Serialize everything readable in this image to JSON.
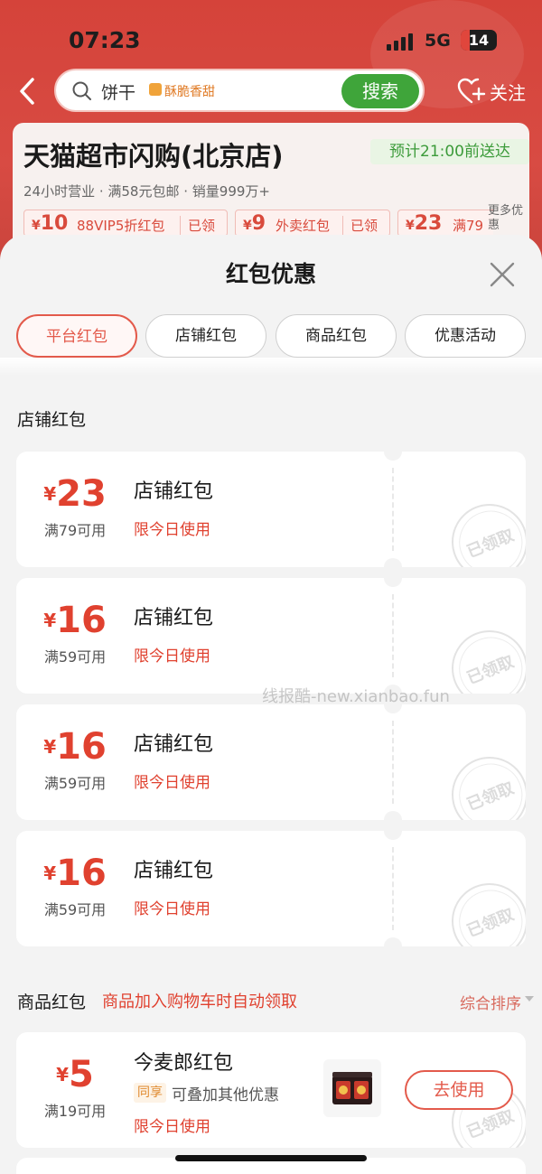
{
  "status": {
    "time": "07:23",
    "network": "5G",
    "battery": "14"
  },
  "header": {
    "search_text": "饼干",
    "search_tag": "酥脆香甜",
    "search_button": "搜索",
    "follow_label": "关注"
  },
  "store": {
    "name": "天猫超市闪购(北京店)",
    "eta": "预计21:00前送达",
    "meta": "24小时营业 · 满58元包邮 · 销量999万+",
    "coupons": [
      {
        "amount": "10",
        "desc": "88VIP5折红包",
        "status": "已领"
      },
      {
        "amount": "9",
        "desc": "外卖红包",
        "status": "已领"
      },
      {
        "amount": "23",
        "desc": "满79",
        "status": ""
      }
    ],
    "more": "更多优惠"
  },
  "sheet": {
    "title": "红包优惠",
    "tabs": [
      "平台红包",
      "店铺红包",
      "商品红包",
      "优惠活动"
    ],
    "active_tab": 0,
    "store_section_title": "店铺红包",
    "store_coupons": [
      {
        "amount": "23",
        "condition": "满79可用",
        "name": "店铺红包",
        "limit": "限今日使用",
        "stamp": "已领取"
      },
      {
        "amount": "16",
        "condition": "满59可用",
        "name": "店铺红包",
        "limit": "限今日使用",
        "stamp": "已领取"
      },
      {
        "amount": "16",
        "condition": "满59可用",
        "name": "店铺红包",
        "limit": "限今日使用",
        "stamp": "已领取"
      },
      {
        "amount": "16",
        "condition": "满59可用",
        "name": "店铺红包",
        "limit": "限今日使用",
        "stamp": "已领取"
      }
    ],
    "watermark": "线报酷-new.xianbao.fun",
    "goods_section": {
      "title": "商品红包",
      "subtitle": "商品加入购物车时自动领取",
      "sort_label": "综合排序"
    },
    "goods_coupons": [
      {
        "amount": "5",
        "condition": "满19可用",
        "name": "今麦郎红包",
        "share_tag": "同享",
        "share_text": "可叠加其他优惠",
        "limit": "限今日使用",
        "button": "去使用",
        "stamp": "已领取"
      }
    ]
  },
  "colors": {
    "accent": "#e35a4b",
    "header_bg": "#d5433a",
    "green": "#3fa53a"
  }
}
